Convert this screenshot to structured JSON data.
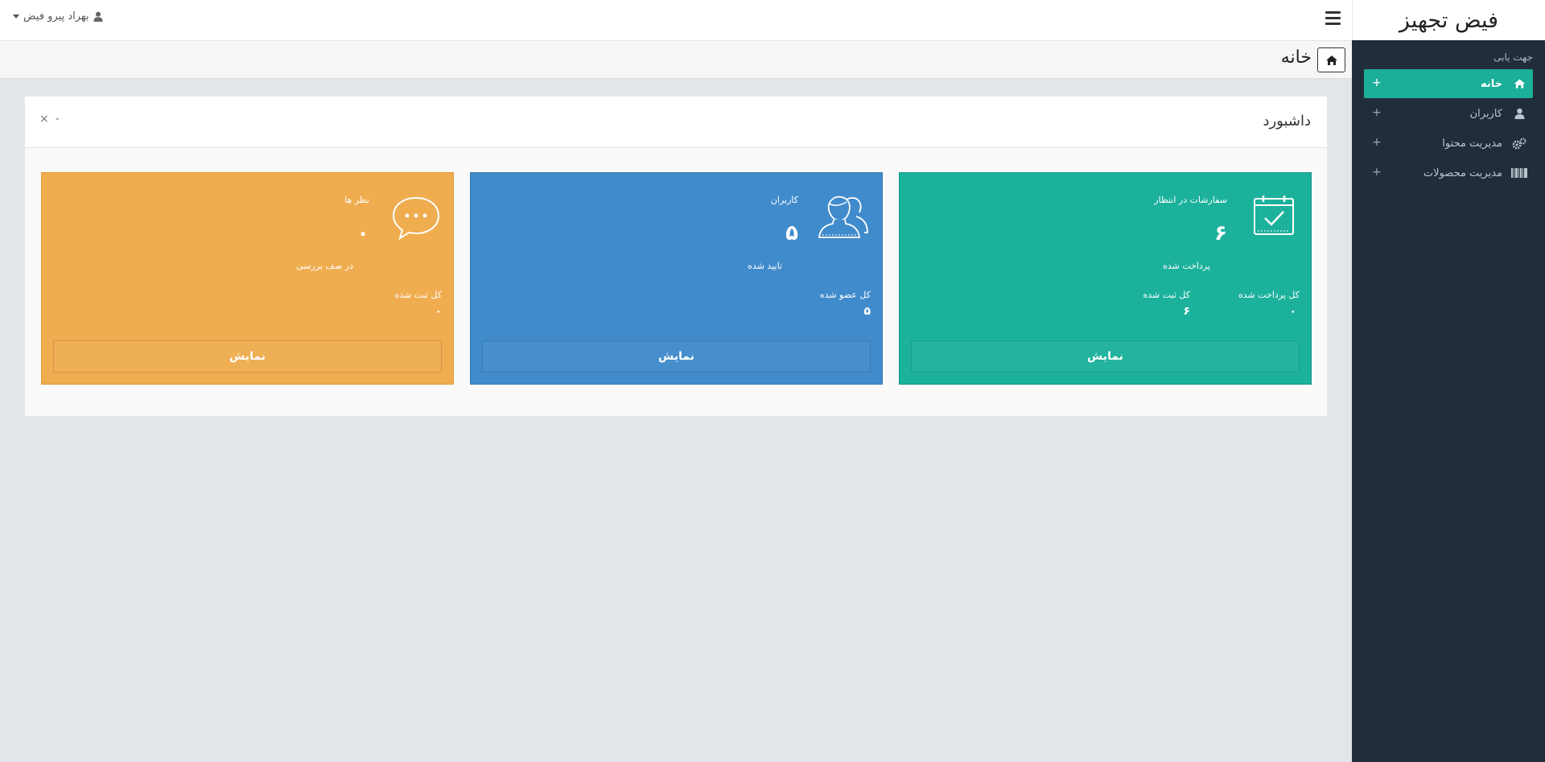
{
  "brand": {
    "title": "فیض تجهیز"
  },
  "sidebar": {
    "caption": "جهت یابی",
    "items": [
      {
        "label": "خانه",
        "icon": "home-icon",
        "active": true
      },
      {
        "label": "کاربران",
        "icon": "user-icon",
        "active": false
      },
      {
        "label": "مدیریت محتوا",
        "icon": "gears-icon",
        "active": false
      },
      {
        "label": "مدیریت محصولات",
        "icon": "barcode-icon",
        "active": false
      }
    ],
    "expand_symbol": "+"
  },
  "topbar": {
    "user_name": "بهراد پیرو فیض",
    "user_icon": "user-icon",
    "menu_icon": "hamburger-icon"
  },
  "page": {
    "title": "خانه",
    "home_icon": "home-icon"
  },
  "dashboard": {
    "title": "داشبورد",
    "minimize": "-",
    "close": "×",
    "cards": {
      "orders": {
        "title": "سفارشات در انتظار",
        "value": "۶",
        "sub": "پرداخت شده",
        "stats": [
          {
            "label": "کل پرداخت شده",
            "value": "۰"
          },
          {
            "label": "کل ثبت شده",
            "value": "۶"
          }
        ],
        "button": "نمایش",
        "color": "#1cb19b",
        "icon": "calendar-check-icon"
      },
      "users": {
        "title": "کاربران",
        "value": "۵",
        "sub": "تایید شده",
        "stats": [
          {
            "label": "کل عضو شده",
            "value": "۵"
          }
        ],
        "button": "نمایش",
        "color": "#408bcb",
        "icon": "users-icon"
      },
      "comments": {
        "title": "نظر ها",
        "value": "۰",
        "sub": "در صف بررسی",
        "stats": [
          {
            "label": "کل ثبت شده",
            "value": "۰"
          }
        ],
        "button": "نمایش",
        "color": "#efad4f",
        "icon": "comment-icon"
      }
    }
  }
}
